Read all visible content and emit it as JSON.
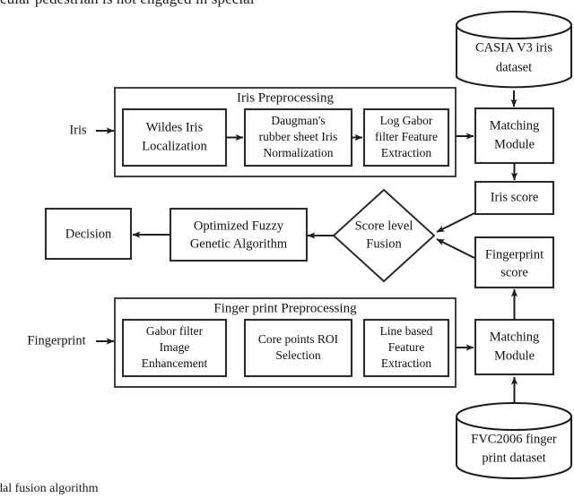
{
  "page": {
    "top_clipped_line": "cular pedestrian is not engaged in special",
    "bottom_caption": "nodal fusion algorithm"
  },
  "inputs": {
    "iris_label": "Iris",
    "fingerprint_label": "Fingerprint"
  },
  "iris_pipeline": {
    "group_title": "Iris Preprocessing",
    "steps": [
      {
        "line1": "Wildes Iris",
        "line2": "Localization",
        "line3": ""
      },
      {
        "line1": "Daugman's",
        "line2": "rubber sheet Iris",
        "line3": "Normalization"
      },
      {
        "line1": "Log Gabor",
        "line2": "filter Feature",
        "line3": "Extraction"
      }
    ]
  },
  "fingerprint_pipeline": {
    "group_title": "Finger print Preprocessing",
    "steps": [
      {
        "line1": "Gabor filter",
        "line2": "Image",
        "line3": "Enhancement"
      },
      {
        "line1": "Core points ROI",
        "line2": "Selection",
        "line3": ""
      },
      {
        "line1": "Line based",
        "line2": "Feature",
        "line3": "Extraction"
      }
    ]
  },
  "datasets": {
    "iris": {
      "line1": "CASIA V3 iris",
      "line2": "dataset"
    },
    "fingerprint": {
      "line1": "FVC2006 finger",
      "line2": "print dataset"
    }
  },
  "matching": {
    "iris_module": {
      "line1": "Matching",
      "line2": "Module"
    },
    "fingerprint_module": {
      "line1": "Matching",
      "line2": "Module"
    }
  },
  "scores": {
    "iris": {
      "line1": "Iris score",
      "line2": ""
    },
    "fingerprint": {
      "line1": "Fingerprint",
      "line2": "score"
    }
  },
  "fusion": {
    "line1": "Score level",
    "line2": "Fusion"
  },
  "classifier": {
    "line1": "Optimized Fuzzy",
    "line2": "Genetic Algorithm"
  },
  "output": {
    "decision": "Decision"
  },
  "colors": {
    "stroke": "#2b2b2b",
    "fill": "#ffffff",
    "text": "#111111"
  }
}
